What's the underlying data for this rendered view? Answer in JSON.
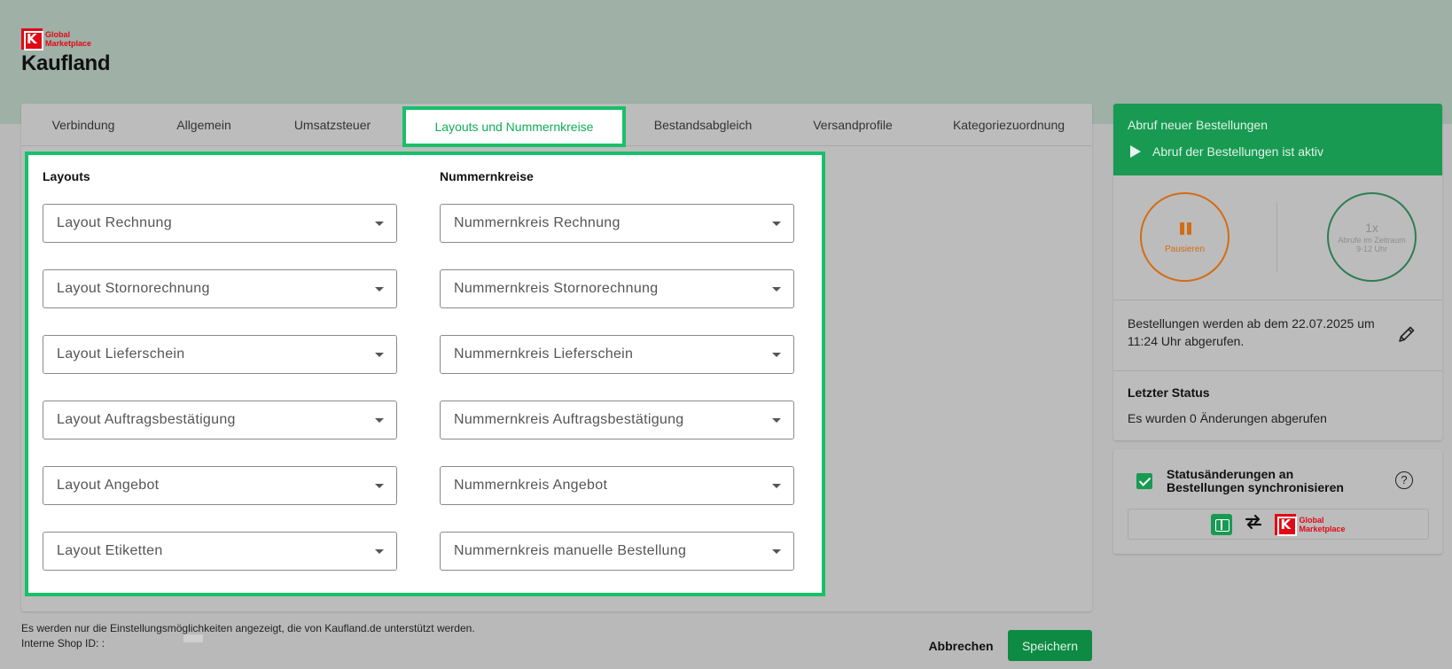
{
  "header": {
    "logo_line1": "Global",
    "logo_line2": "Marketplace",
    "brand": "Kaufland"
  },
  "tabs": [
    {
      "label": "Verbindung"
    },
    {
      "label": "Allgemein"
    },
    {
      "label": "Umsatzsteuer"
    },
    {
      "label": "Layouts und Nummernkreise",
      "active": true
    },
    {
      "label": "Bestandsabgleich"
    },
    {
      "label": "Versandprofile"
    },
    {
      "label": "Kategoriezuordnung"
    }
  ],
  "layouts": {
    "heading": "Layouts",
    "fields": [
      {
        "placeholder": "Layout Rechnung"
      },
      {
        "placeholder": "Layout Stornorechnung"
      },
      {
        "placeholder": "Layout Lieferschein"
      },
      {
        "placeholder": "Layout Auftragsbestätigung"
      },
      {
        "placeholder": "Layout Angebot"
      },
      {
        "placeholder": "Layout Etiketten"
      }
    ]
  },
  "number_ranges": {
    "heading": "Nummernkreise",
    "fields": [
      {
        "placeholder": "Nummernkreis Rechnung"
      },
      {
        "placeholder": "Nummernkreis Stornorechnung"
      },
      {
        "placeholder": "Nummernkreis Lieferschein"
      },
      {
        "placeholder": "Nummernkreis Auftragsbestätigung"
      },
      {
        "placeholder": "Nummernkreis Angebot"
      },
      {
        "placeholder": "Nummernkreis manuelle Bestellung"
      }
    ]
  },
  "footer": {
    "note": "Es werden nur die Einstellungsmöglichkeiten angezeigt, die von Kaufland.de unterstützt werden.",
    "shop_id": "Interne Shop ID: :",
    "cancel_label": "Abbrechen",
    "save_label": "Speichern"
  },
  "order_fetch": {
    "title": "Abruf neuer Bestellungen",
    "status": "Abruf der Bestellungen ist aktiv",
    "pause_label": "Pausieren",
    "count_value": "1x",
    "count_caption_1": "Abrufe im Zeitraum",
    "count_caption_2": "9-12 Uhr",
    "fetch_info": "Bestellungen werden ab dem 22.07.2025 um 11:24 Uhr abgerufen.",
    "last_status_title": "Letzter Status",
    "last_status_text": "Es wurden 0 Änderungen abgerufen"
  },
  "sync": {
    "checked": true,
    "label": "Statusänderungen an Bestellungen synchronisieren",
    "help": "?",
    "logo_line1": "Global",
    "logo_line2": "Marketplace"
  },
  "colors": {
    "accent_green": "#18c06a",
    "button_green": "#0d8a43",
    "brand_red": "#e10915",
    "pause_orange": "#d26d14"
  }
}
